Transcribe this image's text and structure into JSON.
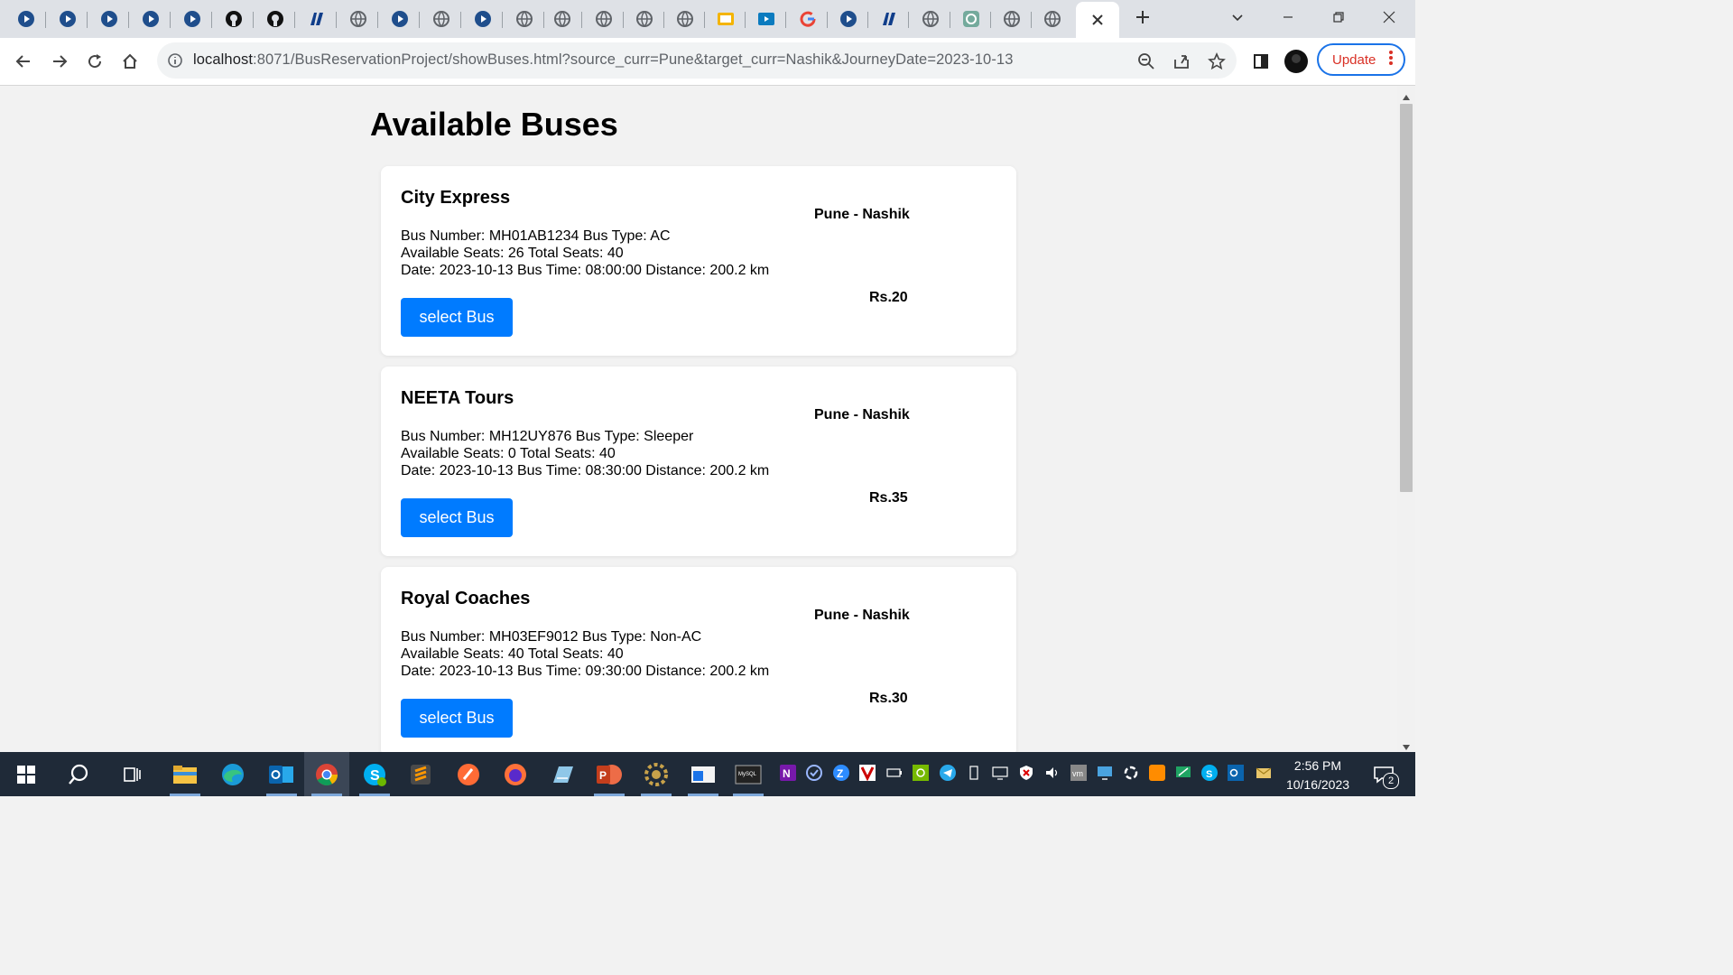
{
  "browser": {
    "tabs": [
      {
        "icon": "globe-play-icon"
      },
      {
        "icon": "globe-play-icon"
      },
      {
        "icon": "globe-play-icon"
      },
      {
        "icon": "globe-play-icon"
      },
      {
        "icon": "globe-play-icon"
      },
      {
        "icon": "github-icon"
      },
      {
        "icon": "github-icon"
      },
      {
        "icon": "blue-logo-icon"
      },
      {
        "icon": "globe-icon"
      },
      {
        "icon": "globe-play-icon"
      },
      {
        "icon": "globe-icon"
      },
      {
        "icon": "globe-play-icon"
      },
      {
        "icon": "globe-icon"
      },
      {
        "icon": "globe-icon"
      },
      {
        "icon": "globe-icon"
      },
      {
        "icon": "globe-icon"
      },
      {
        "icon": "slides-icon"
      },
      {
        "icon": "video-icon"
      },
      {
        "icon": "google-icon"
      },
      {
        "icon": "globe-play-icon"
      },
      {
        "icon": "blue-logo-icon"
      },
      {
        "icon": "globe-icon"
      },
      {
        "icon": "chatgpt-icon"
      },
      {
        "icon": "globe-icon"
      },
      {
        "icon": "globe-icon"
      },
      {
        "icon": "close-icon"
      }
    ],
    "url_host": "localhost",
    "url_rest": ":8071/BusReservationProject/showBuses.html?source_curr=Pune&target_curr=Nashik&JourneyDate=2023-10-13",
    "update_label": "Update"
  },
  "page": {
    "title": "Available Buses"
  },
  "buses": [
    {
      "name": "City Express",
      "route": "Pune - Nashik",
      "line1": "Bus Number: MH01AB1234 Bus Type: AC",
      "line2": "Available Seats: 26 Total Seats: 40",
      "line3": "Date: 2023-10-13 Bus Time: 08:00:00 Distance: 200.2 km",
      "price": "Rs.20",
      "button": "select Bus"
    },
    {
      "name": "NEETA Tours",
      "route": "Pune - Nashik",
      "line1": "Bus Number: MH12UY876 Bus Type: Sleeper",
      "line2": "Available Seats: 0 Total Seats: 40",
      "line3": "Date: 2023-10-13 Bus Time: 08:30:00 Distance: 200.2 km",
      "price": "Rs.35",
      "button": "select Bus"
    },
    {
      "name": "Royal Coaches",
      "route": "Pune - Nashik",
      "line1": "Bus Number: MH03EF9012 Bus Type: Non-AC",
      "line2": "Available Seats: 40 Total Seats: 40",
      "line3": "Date: 2023-10-13 Bus Time: 09:30:00 Distance: 200.2 km",
      "price": "Rs.30",
      "button": "select Bus"
    }
  ],
  "taskbar": {
    "time": "2:56 PM",
    "date": "10/16/2023",
    "notification_count": "2"
  },
  "colors": {
    "accent": "#007bff",
    "page_bg": "#f2f2f2",
    "taskbar_bg": "#1f2a38"
  }
}
